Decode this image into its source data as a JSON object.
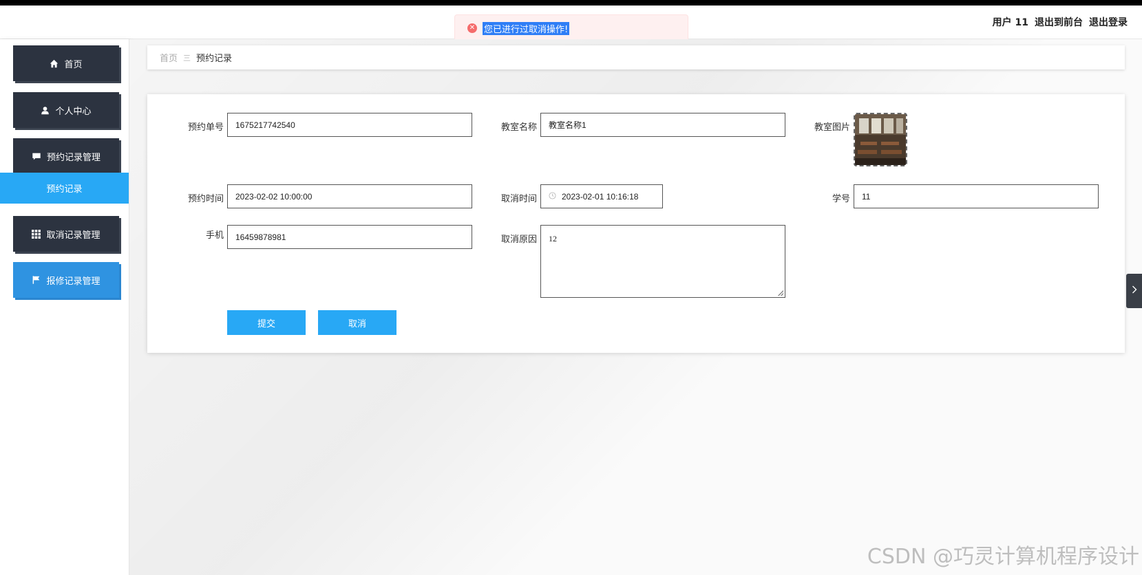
{
  "header": {
    "user_label": "用户 11",
    "back_to_front": "退出到前台",
    "logout": "退出登录"
  },
  "toast": {
    "message": "您已进行过取消操作!"
  },
  "sidebar": {
    "items": [
      {
        "label": "首页",
        "icon": "home-icon"
      },
      {
        "label": "个人中心",
        "icon": "user-icon"
      },
      {
        "label": "预约记录管理",
        "icon": "chat-icon"
      },
      {
        "label": "取消记录管理",
        "icon": "grid-icon"
      },
      {
        "label": "报修记录管理",
        "icon": "flag-icon"
      }
    ],
    "sub_item": "预约记录"
  },
  "breadcrumb": {
    "home": "首页",
    "separator": "三",
    "current": "预约记录"
  },
  "form": {
    "order_no_label": "预约单号",
    "order_no_value": "1675217742540",
    "classroom_name_label": "教室名称",
    "classroom_name_value": "教室名称1",
    "classroom_image_label": "教室图片",
    "booking_time_label": "预约时间",
    "booking_time_value": "2023-02-02 10:00:00",
    "cancel_time_label": "取消时间",
    "cancel_time_value": "2023-02-01 10:16:18",
    "student_no_label": "学号",
    "student_no_value": "11",
    "phone_label": "手机",
    "phone_value": "16459878981",
    "cancel_reason_label": "取消原因",
    "cancel_reason_value": "12",
    "submit_label": "提交",
    "cancel_label": "取消"
  },
  "watermark": "CSDN @巧灵计算机程序设计",
  "colors": {
    "sidebar_button": "#2c3340",
    "accent_blue": "#28a8f5",
    "active_menu": "#2f93e1",
    "toast_bg": "#fef0f0",
    "toast_icon": "#f56c6c"
  }
}
